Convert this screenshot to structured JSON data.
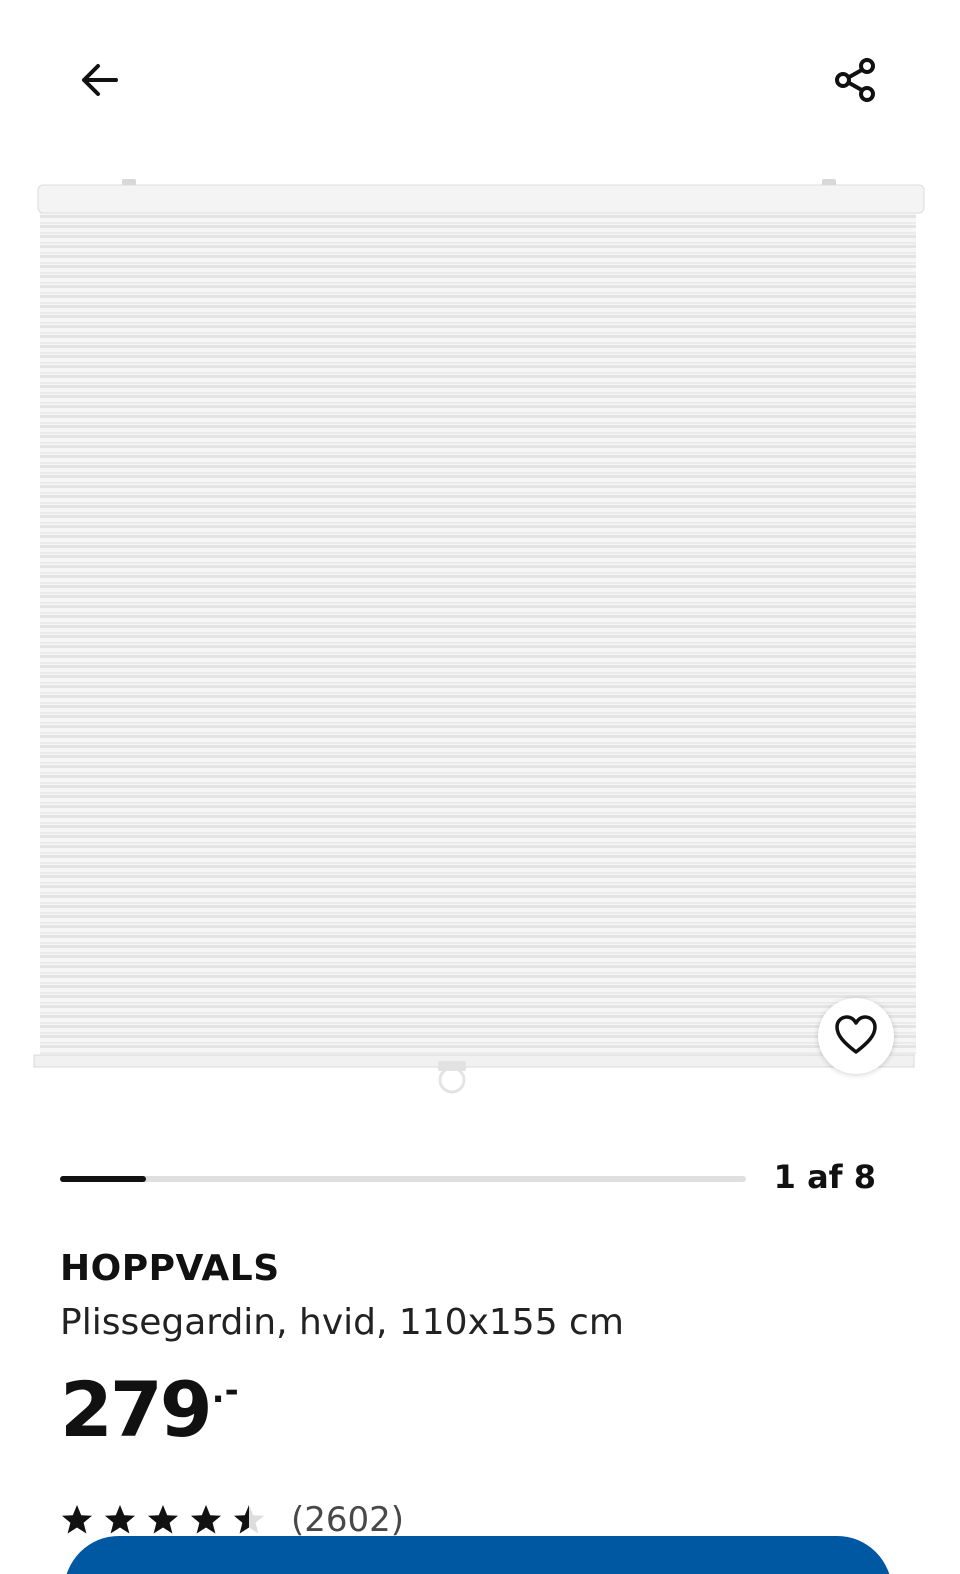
{
  "header": {
    "back_icon": "arrow-left-icon",
    "share_icon": "share-icon"
  },
  "gallery": {
    "image": "white pleated blind",
    "favourite_icon": "heart-icon",
    "current_index": 1,
    "total": 8,
    "counter_text": "1 af 8"
  },
  "product": {
    "name": "HOPPVALS",
    "description": "Plissegardin, hvid, 110x155 cm",
    "price": "279",
    "price_suffix": ".-",
    "rating": 4.5,
    "review_count": "(2602)"
  },
  "colors": {
    "text": "#111111",
    "progress_track": "#dfdfdf",
    "primary": "#0058a3"
  }
}
